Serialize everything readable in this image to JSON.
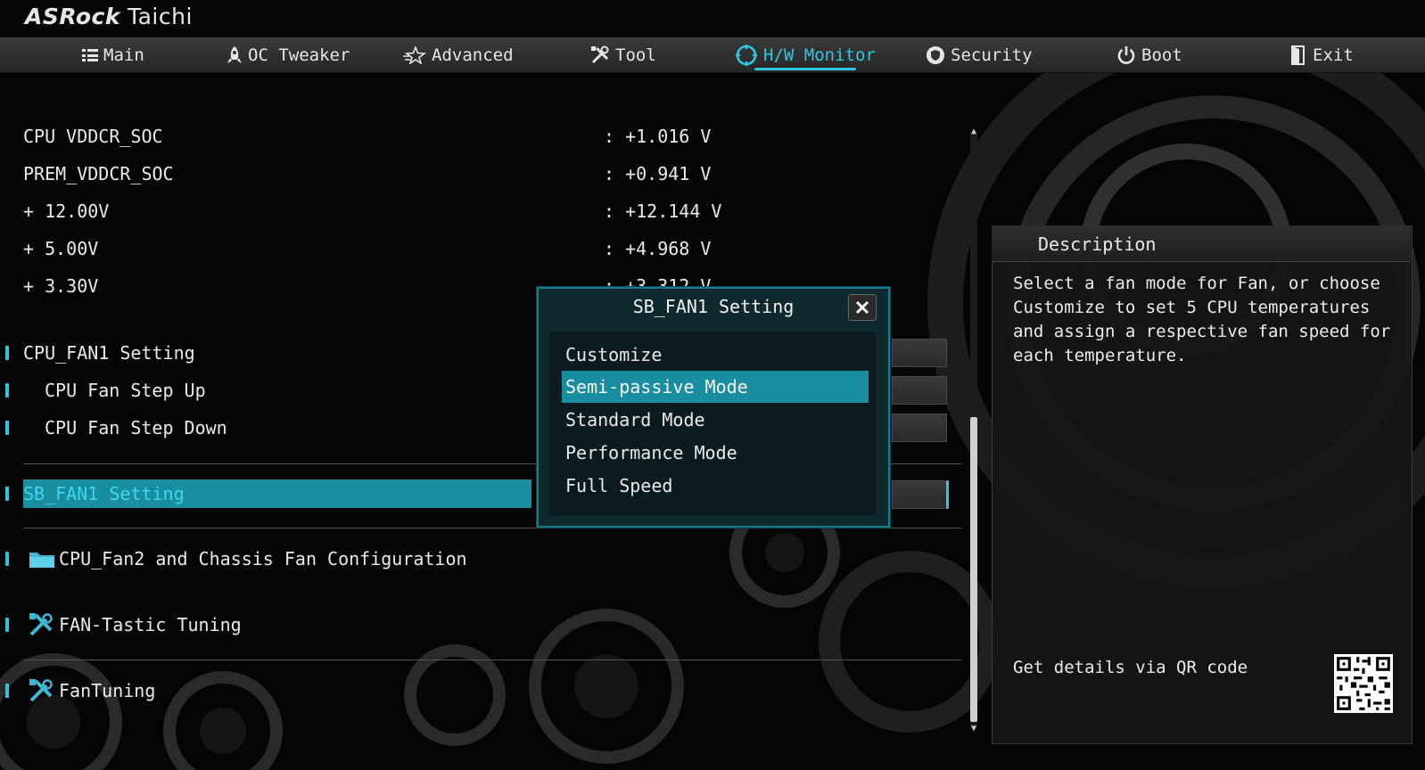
{
  "brand": {
    "name": "ASRock",
    "model": "Taichi"
  },
  "nav": {
    "tabs": [
      {
        "label": "Main",
        "icon": "list-icon"
      },
      {
        "label": "OC Tweaker",
        "icon": "rocket-icon"
      },
      {
        "label": "Advanced",
        "icon": "star-icon"
      },
      {
        "label": "Tool",
        "icon": "tools-icon"
      },
      {
        "label": "H/W Monitor",
        "icon": "monitor-icon",
        "active": true
      },
      {
        "label": "Security",
        "icon": "shield-icon"
      },
      {
        "label": "Boot",
        "icon": "power-icon"
      },
      {
        "label": "Exit",
        "icon": "exit-door-icon"
      }
    ]
  },
  "voltages": [
    {
      "label": "CPU VDDCR_SOC",
      "value": ": +1.016 V"
    },
    {
      "label": "PREM_VDDCR_SOC",
      "value": ": +0.941 V"
    },
    {
      "label": "+ 12.00V",
      "value": ": +12.144 V"
    },
    {
      "label": "+ 5.00V",
      "value": ": +4.968 V"
    },
    {
      "label": "+ 3.30V",
      "value": ": +3.312 V"
    }
  ],
  "settings": {
    "cpu_fan1": "CPU_FAN1 Setting",
    "step_up": "CPU Fan Step Up",
    "step_down": "CPU Fan Step Down",
    "sb_fan1": "SB_FAN1 Setting",
    "chassis": "CPU_Fan2 and Chassis Fan Configuration",
    "fantastic": "FAN-Tastic Tuning",
    "fantuning": "FanTuning"
  },
  "popup": {
    "title": "SB_FAN1 Setting",
    "options": [
      "Customize",
      "Semi-passive Mode",
      "Standard Mode",
      "Performance Mode",
      "Full Speed"
    ],
    "selected": "Semi-passive Mode"
  },
  "description": {
    "title": "Description",
    "text": "Select a fan mode for Fan, or choose\nCustomize to set 5 CPU temperatures\nand assign a respective fan speed for\neach temperature.",
    "qr_label": "Get details via QR code"
  },
  "colors": {
    "accent": "#2fc6e0",
    "highlight": "#1a8ea1"
  }
}
